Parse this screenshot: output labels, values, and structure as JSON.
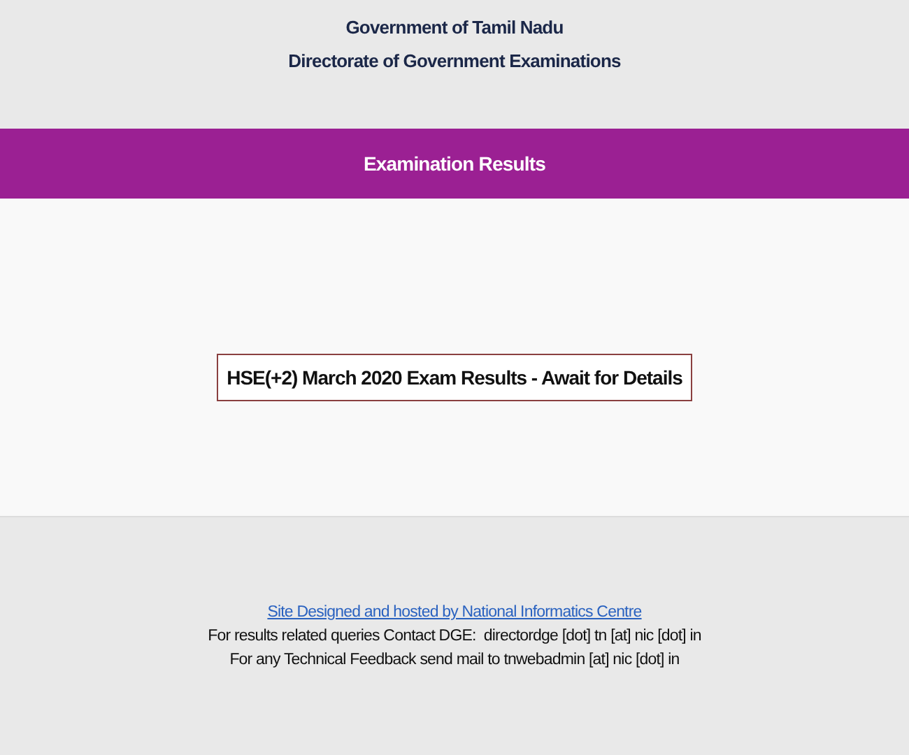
{
  "header": {
    "lines": [
      "Government of Tamil Nadu",
      "Directorate of Government Examinations"
    ]
  },
  "banner": {
    "title": "Examination Results"
  },
  "notice": "HSE(+2) March 2020 Exam Results - Await for Details",
  "footer": {
    "link": "Site Designed and hosted by National Informatics Centre",
    "lines": [
      "For results related queries Contact DGE:  directordge [dot] tn [at] nic [dot] in",
      "For any Technical Feedback send mail to tnwebadmin [at] nic [dot] in"
    ]
  }
}
